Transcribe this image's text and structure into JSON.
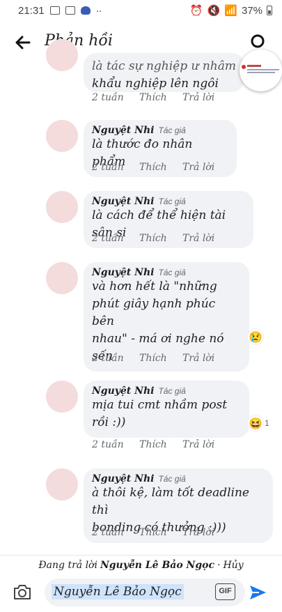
{
  "status_bar": {
    "time": "21:31",
    "battery": "37%"
  },
  "header": {
    "title": "Phản hồi"
  },
  "colors": {
    "accent": "#1877f2",
    "bubble": "#f0f2f5",
    "meta": "#65676b"
  },
  "top_comment": {
    "partial_line": "là tác sự nghiệp ư nhâm",
    "body": "khẩu nghiệp lên ngôi",
    "time": "2 tuần",
    "like": "Thích",
    "reply": "Trả lời"
  },
  "comments": [
    {
      "author": "Nguyệt Nhi",
      "badge": "Tác giả",
      "lines": [
        "là thước đo nhân phẩm"
      ],
      "time": "2 tuần",
      "like": "Thích",
      "reply": "Trả lời"
    },
    {
      "author": "Nguyệt Nhi",
      "badge": "Tác giả",
      "lines": [
        "là cách để thể hiện tài sân si"
      ],
      "time": "2 tuần",
      "like": "Thích",
      "reply": "Trả lời"
    },
    {
      "author": "Nguyệt Nhi",
      "badge": "Tác giả",
      "lines": [
        "và hơn hết là \"những",
        "phút giây hạnh phúc bên",
        "nhau\" - má ơi nghe nó",
        "sến"
      ],
      "time": "2 tuần",
      "like": "Thích",
      "reply": "Trả lời",
      "reaction_icon": "sad-emoji-icon",
      "reaction_count": ""
    },
    {
      "author": "Nguyệt Nhi",
      "badge": "Tác giả",
      "lines": [
        "mịa tui cmt nhầm post",
        "rồi :))"
      ],
      "time": "2 tuần",
      "like": "Thích",
      "reply": "Trả lời",
      "reaction_icon": "haha-emoji-icon",
      "reaction_count": "1"
    },
    {
      "author": "Nguyệt Nhi",
      "badge": "Tác giả",
      "lines": [
        "à thôi kệ, làm tốt deadline thì",
        "bonding có thưởng :)))"
      ],
      "time": "2 tuần",
      "like": "Thích",
      "reply": "Trả lời"
    }
  ],
  "reply_bar": {
    "prefix": "Đang trả lời",
    "name": "Nguyễn Lê Bảo Ngọc",
    "separator": "·",
    "cancel": "Hủy"
  },
  "composer": {
    "value": "Nguyễn Lê Bảo Ngọc",
    "gif_label": "GIF"
  }
}
